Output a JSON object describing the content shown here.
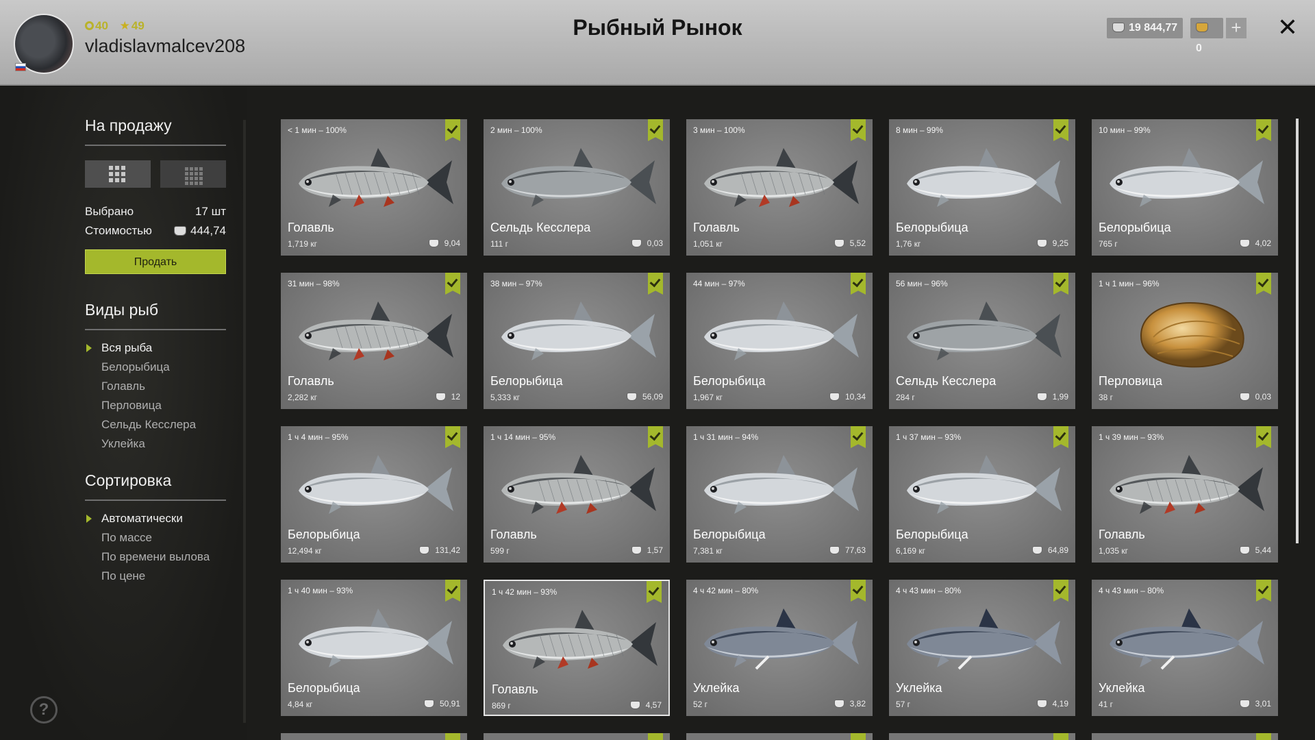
{
  "header": {
    "level": "40",
    "stars": "49",
    "username": "vladislavmalcev208",
    "title": "Рыбный Рынок",
    "silver": "19 844,77",
    "gold": "0",
    "plus_label": "+",
    "close_label": "✕"
  },
  "sidebar": {
    "sale_heading": "На продажу",
    "selected_label": "Выбрано",
    "selected_value": "17 шт",
    "cost_label": "Стоимостью",
    "cost_value": "444,74",
    "sell_button": "Продать",
    "species_heading": "Виды рыб",
    "species": [
      "Вся рыба",
      "Белорыбица",
      "Голавль",
      "Перловица",
      "Сельдь Кесслера",
      "Уклейка"
    ],
    "species_active": 0,
    "sort_heading": "Сортировка",
    "sort": [
      "Автоматически",
      "По массе",
      "По времени вылова",
      "По цене"
    ],
    "sort_active": 0,
    "help": "?"
  },
  "cards": [
    {
      "time": "< 1 мин – 100%",
      "name": "Голавль",
      "weight": "1,719 кг",
      "price": "9,04",
      "kind": "chub"
    },
    {
      "time": "2 мин – 100%",
      "name": "Сельдь Кесслера",
      "weight": "111 г",
      "price": "0,03",
      "kind": "herring"
    },
    {
      "time": "3 мин – 100%",
      "name": "Голавль",
      "weight": "1,051 кг",
      "price": "5,52",
      "kind": "chub"
    },
    {
      "time": "8 мин – 99%",
      "name": "Белорыбица",
      "weight": "1,76 кг",
      "price": "9,25",
      "kind": "whitefish"
    },
    {
      "time": "10 мин – 99%",
      "name": "Белорыбица",
      "weight": "765 г",
      "price": "4,02",
      "kind": "whitefish"
    },
    {
      "time": "31 мин – 98%",
      "name": "Голавль",
      "weight": "2,282 кг",
      "price": "12",
      "kind": "chub"
    },
    {
      "time": "38 мин – 97%",
      "name": "Белорыбица",
      "weight": "5,333 кг",
      "price": "56,09",
      "kind": "whitefish"
    },
    {
      "time": "44 мин – 97%",
      "name": "Белорыбица",
      "weight": "1,967 кг",
      "price": "10,34",
      "kind": "whitefish"
    },
    {
      "time": "56 мин – 96%",
      "name": "Сельдь Кесслера",
      "weight": "284 г",
      "price": "1,99",
      "kind": "herring"
    },
    {
      "time": "1 ч 1 мин – 96%",
      "name": "Перловица",
      "weight": "38 г",
      "price": "0,03",
      "kind": "mussel"
    },
    {
      "time": "1 ч 4 мин – 95%",
      "name": "Белорыбица",
      "weight": "12,494 кг",
      "price": "131,42",
      "kind": "whitefish"
    },
    {
      "time": "1 ч 14 мин – 95%",
      "name": "Голавль",
      "weight": "599 г",
      "price": "1,57",
      "kind": "chub"
    },
    {
      "time": "1 ч 31 мин – 94%",
      "name": "Белорыбица",
      "weight": "7,381 кг",
      "price": "77,63",
      "kind": "whitefish"
    },
    {
      "time": "1 ч 37 мин – 93%",
      "name": "Белорыбица",
      "weight": "6,169 кг",
      "price": "64,89",
      "kind": "whitefish"
    },
    {
      "time": "1 ч 39 мин – 93%",
      "name": "Голавль",
      "weight": "1,035 кг",
      "price": "5,44",
      "kind": "chub"
    },
    {
      "time": "1 ч 40 мин – 93%",
      "name": "Белорыбица",
      "weight": "4,84 кг",
      "price": "50,91",
      "kind": "whitefish"
    },
    {
      "time": "1 ч 42 мин – 93%",
      "name": "Голавль",
      "weight": "869 г",
      "price": "4,57",
      "kind": "chub",
      "selected": true
    },
    {
      "time": "4 ч 42 мин – 80%",
      "name": "Уклейка",
      "weight": "52 г",
      "price": "3,82",
      "kind": "bleak"
    },
    {
      "time": "4 ч 43 мин – 80%",
      "name": "Уклейка",
      "weight": "57 г",
      "price": "4,19",
      "kind": "bleak"
    },
    {
      "time": "4 ч 43 мин – 80%",
      "name": "Уклейка",
      "weight": "41 г",
      "price": "3,01",
      "kind": "bleak"
    }
  ],
  "colors": {
    "accent": "#a4b82c",
    "header_bg": "#b9b9b9",
    "card_bg": "#7d7d7d"
  }
}
